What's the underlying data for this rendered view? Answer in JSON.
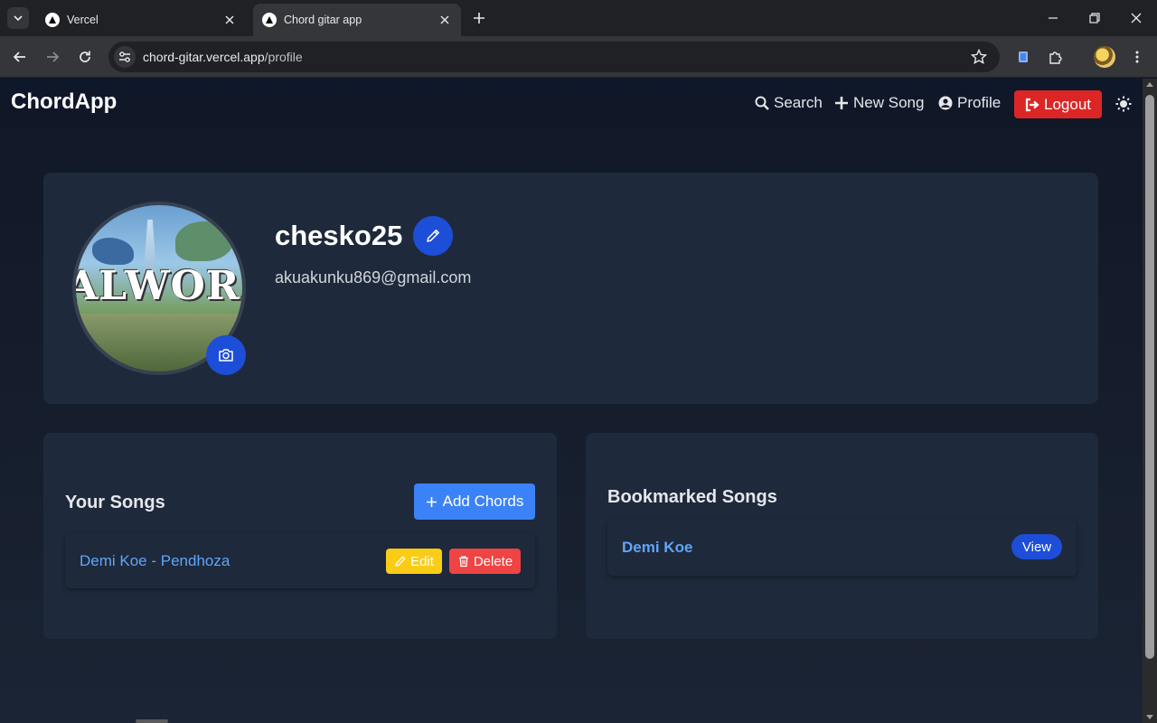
{
  "browser": {
    "tabs": [
      {
        "title": "Vercel",
        "active": false
      },
      {
        "title": "Chord gitar app",
        "active": true
      }
    ],
    "url_host": "chord-gitar.vercel.app",
    "url_path": "/profile"
  },
  "nav": {
    "brand": "ChordApp",
    "search": "Search",
    "new_song": "New Song",
    "profile": "Profile",
    "logout": "Logout"
  },
  "profile": {
    "avatar_text": "ALWORL",
    "username": "chesko25",
    "email": "akuakunku869@gmail.com"
  },
  "your_songs": {
    "title": "Your Songs",
    "add_label": "Add Chords",
    "items": [
      {
        "title": "Demi Koe - Pendhoza",
        "edit": "Edit",
        "delete": "Delete"
      }
    ]
  },
  "bookmarks": {
    "title": "Bookmarked Songs",
    "items": [
      {
        "title": "Demi Koe",
        "action": "View"
      }
    ]
  },
  "colors": {
    "page_bg": "#111827",
    "card_bg": "#1e293b",
    "primary": "#1d4ed8",
    "add_button": "#3b82f6",
    "logout": "#dc2626",
    "edit": "#facc15",
    "delete": "#ef4444",
    "link": "#60a5fa"
  }
}
